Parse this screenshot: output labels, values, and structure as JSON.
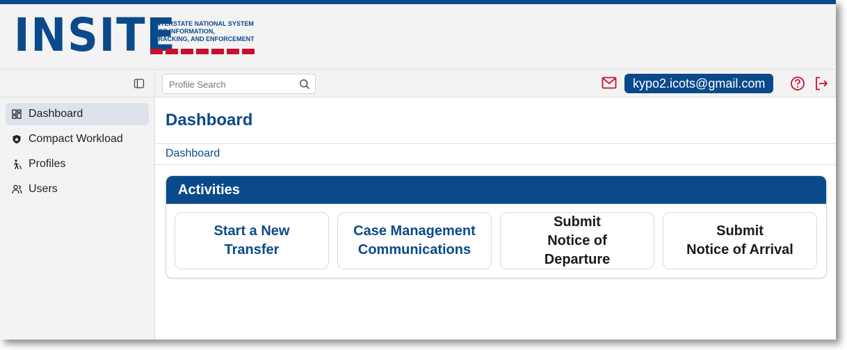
{
  "app": {
    "logo_word": "INSITE",
    "tagline": [
      "INTERSTATE NATIONAL SYSTEM",
      "FOR INFORMATION,",
      "TRACKING, AND ENFORCEMENT"
    ]
  },
  "search": {
    "placeholder": "Profile Search"
  },
  "header": {
    "user_email": "kypo2.icots@gmail.com"
  },
  "sidebar": {
    "items": [
      {
        "label": "Dashboard",
        "icon": "dashboard-icon",
        "active": true
      },
      {
        "label": "Compact Workload",
        "icon": "shield-icon",
        "active": false
      },
      {
        "label": "Profiles",
        "icon": "person-walking-icon",
        "active": false
      },
      {
        "label": "Users",
        "icon": "users-icon",
        "active": false
      }
    ]
  },
  "page": {
    "title": "Dashboard",
    "breadcrumb": "Dashboard"
  },
  "activities": {
    "title": "Activities",
    "actions": [
      {
        "lines": [
          "Start a New",
          "Transfer"
        ]
      },
      {
        "lines": [
          "Case Management",
          "Communications"
        ]
      },
      {
        "lines": [
          "Submit",
          "Notice of",
          "Departure"
        ]
      },
      {
        "lines": [
          "Submit",
          "Notice of Arrival"
        ]
      }
    ]
  },
  "colors": {
    "brand_blue": "#0b4a8a",
    "accent_red": "#c8102e",
    "sidebar_bg": "#f3f3f3",
    "active_item_bg": "#dde3ea"
  }
}
